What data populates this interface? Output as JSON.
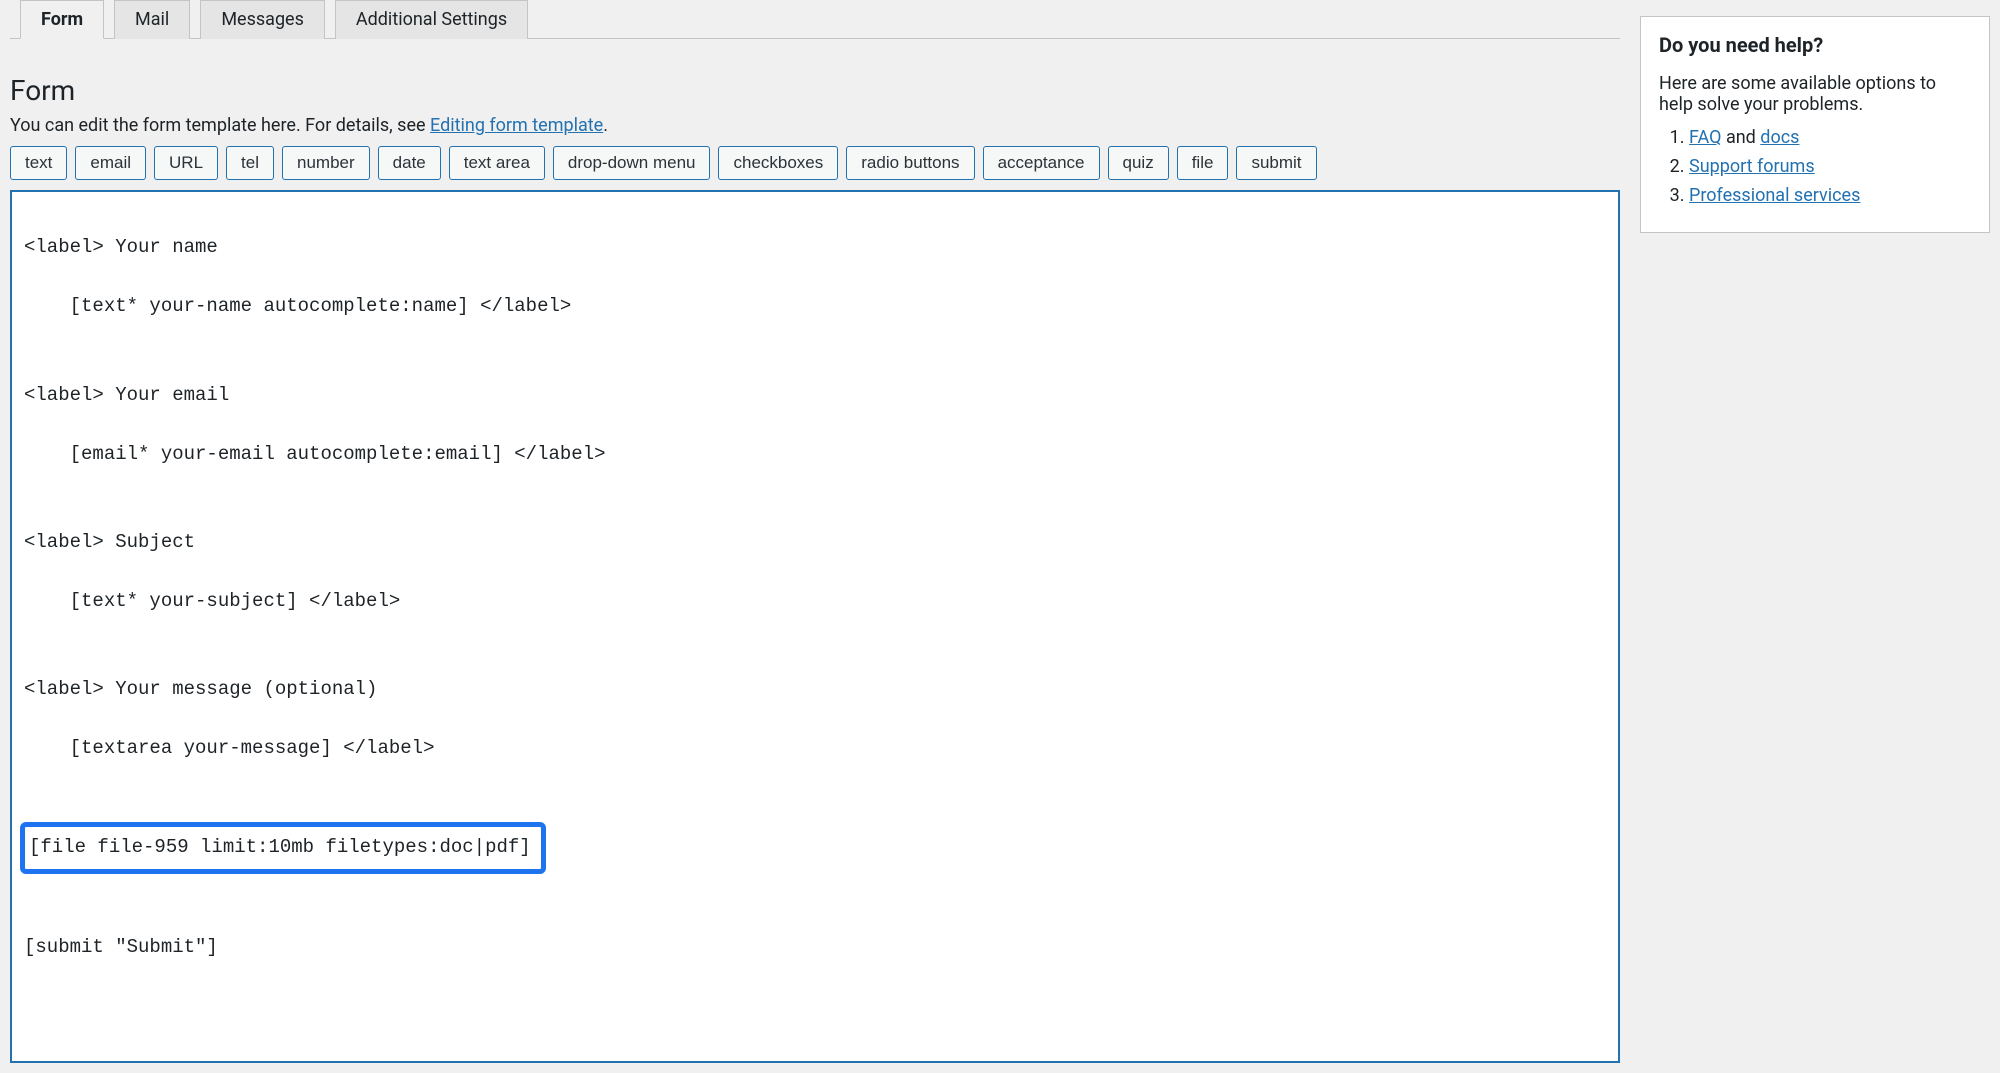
{
  "tabs": [
    {
      "label": "Form",
      "active": true
    },
    {
      "label": "Mail",
      "active": false
    },
    {
      "label": "Messages",
      "active": false
    },
    {
      "label": "Additional Settings",
      "active": false
    }
  ],
  "section": {
    "title": "Form",
    "desc_prefix": "You can edit the form template here. For details, see ",
    "desc_link": "Editing form template",
    "desc_suffix": "."
  },
  "tag_buttons": [
    "text",
    "email",
    "URL",
    "tel",
    "number",
    "date",
    "text area",
    "drop-down menu",
    "checkboxes",
    "radio buttons",
    "acceptance",
    "quiz",
    "file",
    "submit"
  ],
  "code": {
    "l1a": "<label> Your name",
    "l1b": "    [text* your-name autocomplete:name] </label>",
    "blank": "",
    "l2a": "<label> Your email",
    "l2b": "    [email* your-email autocomplete:email] </label>",
    "l3a": "<label> Subject",
    "l3b": "    [text* your-subject] </label>",
    "l4a": "<label> Your message (optional)",
    "l4b": "    [textarea your-message] </label>",
    "file": "[file file-959 limit:10mb filetypes:doc|pdf]",
    "submit": "[submit \"Submit\"]"
  },
  "help": {
    "title": "Do you need help?",
    "intro": "Here are some available options to help solve your problems.",
    "items": [
      {
        "link": "FAQ",
        "rest": " and ",
        "link2": "docs"
      },
      {
        "link": "Support forums",
        "rest": "",
        "link2": ""
      },
      {
        "link": "Professional services",
        "rest": "",
        "link2": ""
      }
    ]
  }
}
